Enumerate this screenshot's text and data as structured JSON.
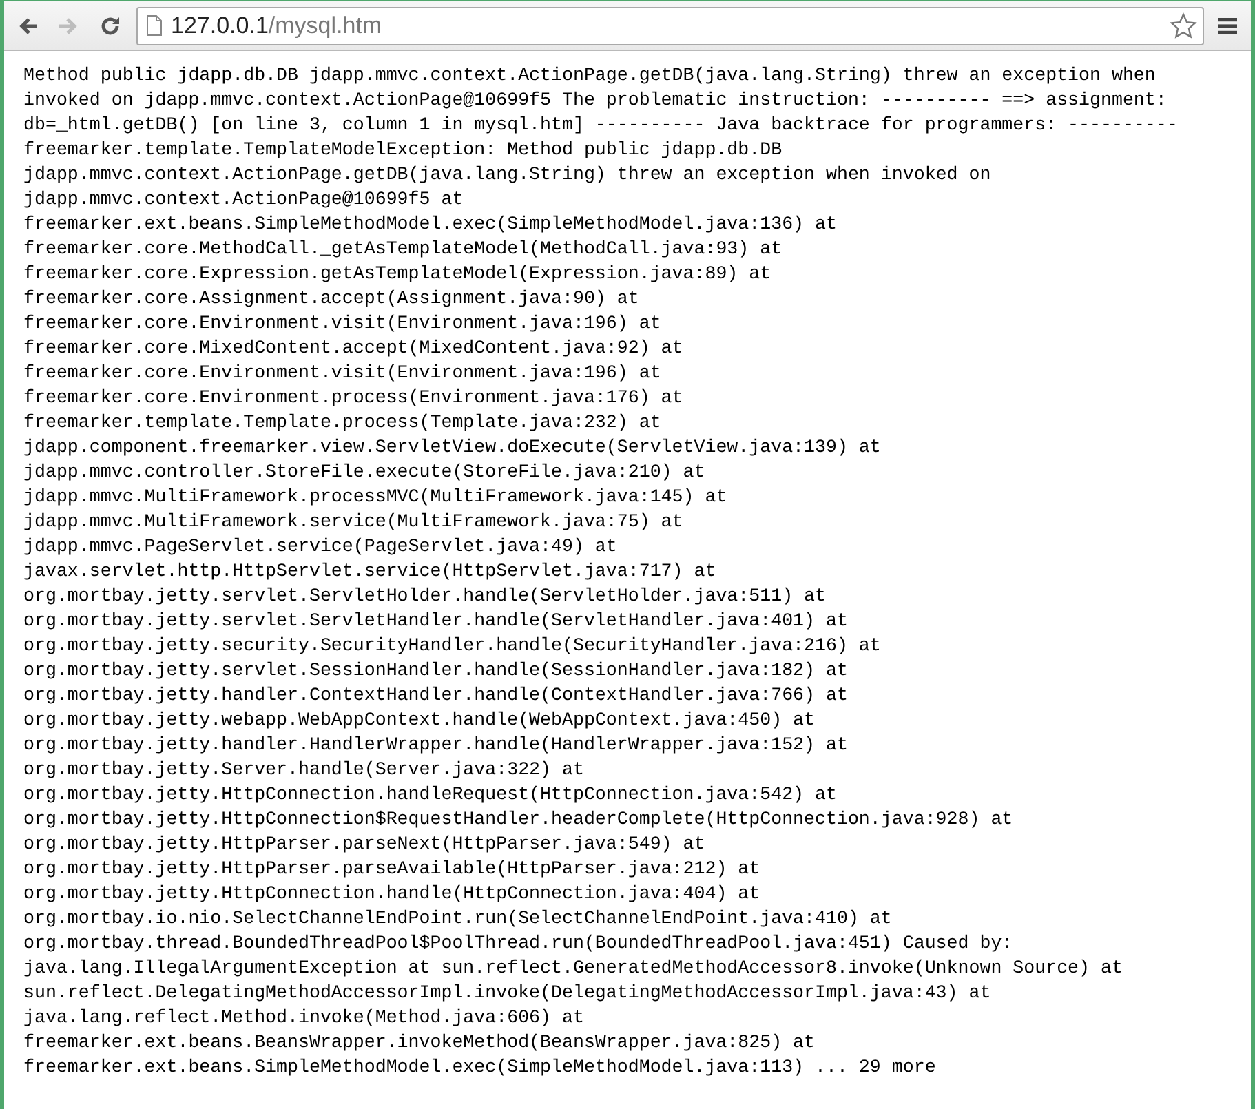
{
  "toolbar": {
    "back": {
      "disabled": false
    },
    "forward": {
      "disabled": true
    },
    "address": {
      "host": "127.0.0.1",
      "path": "/mysql.htm"
    },
    "bookmark": {
      "starred": false
    }
  },
  "page": {
    "lines": [
      "Method public jdapp.db.DB jdapp.mmvc.context.ActionPage.getDB(java.lang.String) threw an exception when",
      "invoked on jdapp.mmvc.context.ActionPage@10699f5 The problematic instruction: ---------- ==> assignment:",
      "db=_html.getDB() [on line 3, column 1 in mysql.htm] ---------- Java backtrace for programmers: ----------",
      "freemarker.template.TemplateModelException: Method public jdapp.db.DB",
      "jdapp.mmvc.context.ActionPage.getDB(java.lang.String) threw an exception when invoked on",
      "jdapp.mmvc.context.ActionPage@10699f5 at",
      "freemarker.ext.beans.SimpleMethodModel.exec(SimpleMethodModel.java:136) at",
      "freemarker.core.MethodCall._getAsTemplateModel(MethodCall.java:93) at",
      "freemarker.core.Expression.getAsTemplateModel(Expression.java:89) at",
      "freemarker.core.Assignment.accept(Assignment.java:90) at",
      "freemarker.core.Environment.visit(Environment.java:196) at",
      "freemarker.core.MixedContent.accept(MixedContent.java:92) at",
      "freemarker.core.Environment.visit(Environment.java:196) at",
      "freemarker.core.Environment.process(Environment.java:176) at",
      "freemarker.template.Template.process(Template.java:232) at",
      "jdapp.component.freemarker.view.ServletView.doExecute(ServletView.java:139) at",
      "jdapp.mmvc.controller.StoreFile.execute(StoreFile.java:210) at",
      "jdapp.mmvc.MultiFramework.processMVC(MultiFramework.java:145) at",
      "jdapp.mmvc.MultiFramework.service(MultiFramework.java:75) at",
      "jdapp.mmvc.PageServlet.service(PageServlet.java:49) at",
      "javax.servlet.http.HttpServlet.service(HttpServlet.java:717) at",
      "org.mortbay.jetty.servlet.ServletHolder.handle(ServletHolder.java:511) at",
      "org.mortbay.jetty.servlet.ServletHandler.handle(ServletHandler.java:401) at",
      "org.mortbay.jetty.security.SecurityHandler.handle(SecurityHandler.java:216) at",
      "org.mortbay.jetty.servlet.SessionHandler.handle(SessionHandler.java:182) at",
      "org.mortbay.jetty.handler.ContextHandler.handle(ContextHandler.java:766) at",
      "org.mortbay.jetty.webapp.WebAppContext.handle(WebAppContext.java:450) at",
      "org.mortbay.jetty.handler.HandlerWrapper.handle(HandlerWrapper.java:152) at",
      "org.mortbay.jetty.Server.handle(Server.java:322) at",
      "org.mortbay.jetty.HttpConnection.handleRequest(HttpConnection.java:542) at",
      "org.mortbay.jetty.HttpConnection$RequestHandler.headerComplete(HttpConnection.java:928) at",
      "org.mortbay.jetty.HttpParser.parseNext(HttpParser.java:549) at",
      "org.mortbay.jetty.HttpParser.parseAvailable(HttpParser.java:212) at",
      "org.mortbay.jetty.HttpConnection.handle(HttpConnection.java:404) at",
      "org.mortbay.io.nio.SelectChannelEndPoint.run(SelectChannelEndPoint.java:410) at",
      "org.mortbay.thread.BoundedThreadPool$PoolThread.run(BoundedThreadPool.java:451) Caused by:",
      "java.lang.IllegalArgumentException at sun.reflect.GeneratedMethodAccessor8.invoke(Unknown Source) at",
      "sun.reflect.DelegatingMethodAccessorImpl.invoke(DelegatingMethodAccessorImpl.java:43) at",
      "java.lang.reflect.Method.invoke(Method.java:606) at",
      "freemarker.ext.beans.BeansWrapper.invokeMethod(BeansWrapper.java:825) at",
      "freemarker.ext.beans.SimpleMethodModel.exec(SimpleMethodModel.java:113) ... 29 more"
    ]
  }
}
